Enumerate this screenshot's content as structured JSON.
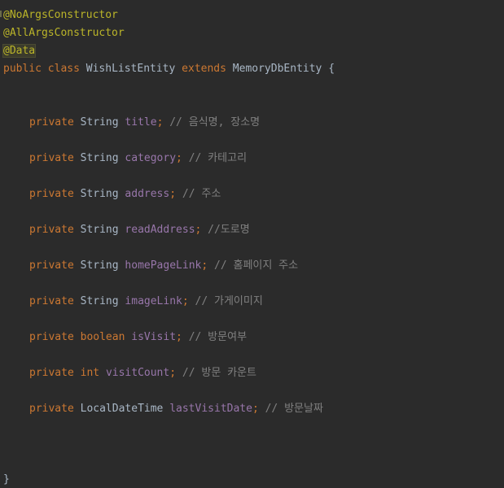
{
  "editor": {
    "annotations": [
      "@NoArgsConstructor",
      "@AllArgsConstructor",
      "@Data"
    ],
    "class_decl": {
      "kw_public": "public",
      "kw_class": "class",
      "name": "WishListEntity",
      "kw_extends": "extends",
      "parent": "MemoryDbEntity",
      "open_brace": "{"
    },
    "fields": [
      {
        "modifier": "private",
        "type": "String",
        "name": "title",
        "comment": "// 음식명, 장소명"
      },
      {
        "modifier": "private",
        "type": "String",
        "name": "category",
        "comment": "// 카테고리"
      },
      {
        "modifier": "private",
        "type": "String",
        "name": "address",
        "comment": "// 주소"
      },
      {
        "modifier": "private",
        "type": "String",
        "name": "readAddress",
        "comment": "//도로명"
      },
      {
        "modifier": "private",
        "type": "String",
        "name": "homePageLink",
        "comment": "// 홈페이지 주소"
      },
      {
        "modifier": "private",
        "type": "String",
        "name": "imageLink",
        "comment": "// 가게이미지"
      },
      {
        "modifier": "private",
        "type": "boolean",
        "name": "isVisit",
        "comment": "// 방문여부"
      },
      {
        "modifier": "private",
        "type": "int",
        "name": "visitCount",
        "comment": "// 방문 카운트"
      },
      {
        "modifier": "private",
        "type": "LocalDateTime",
        "name": "lastVisitDate",
        "comment": "// 방문날짜"
      }
    ],
    "semicolon": ";",
    "close_brace": "}"
  }
}
